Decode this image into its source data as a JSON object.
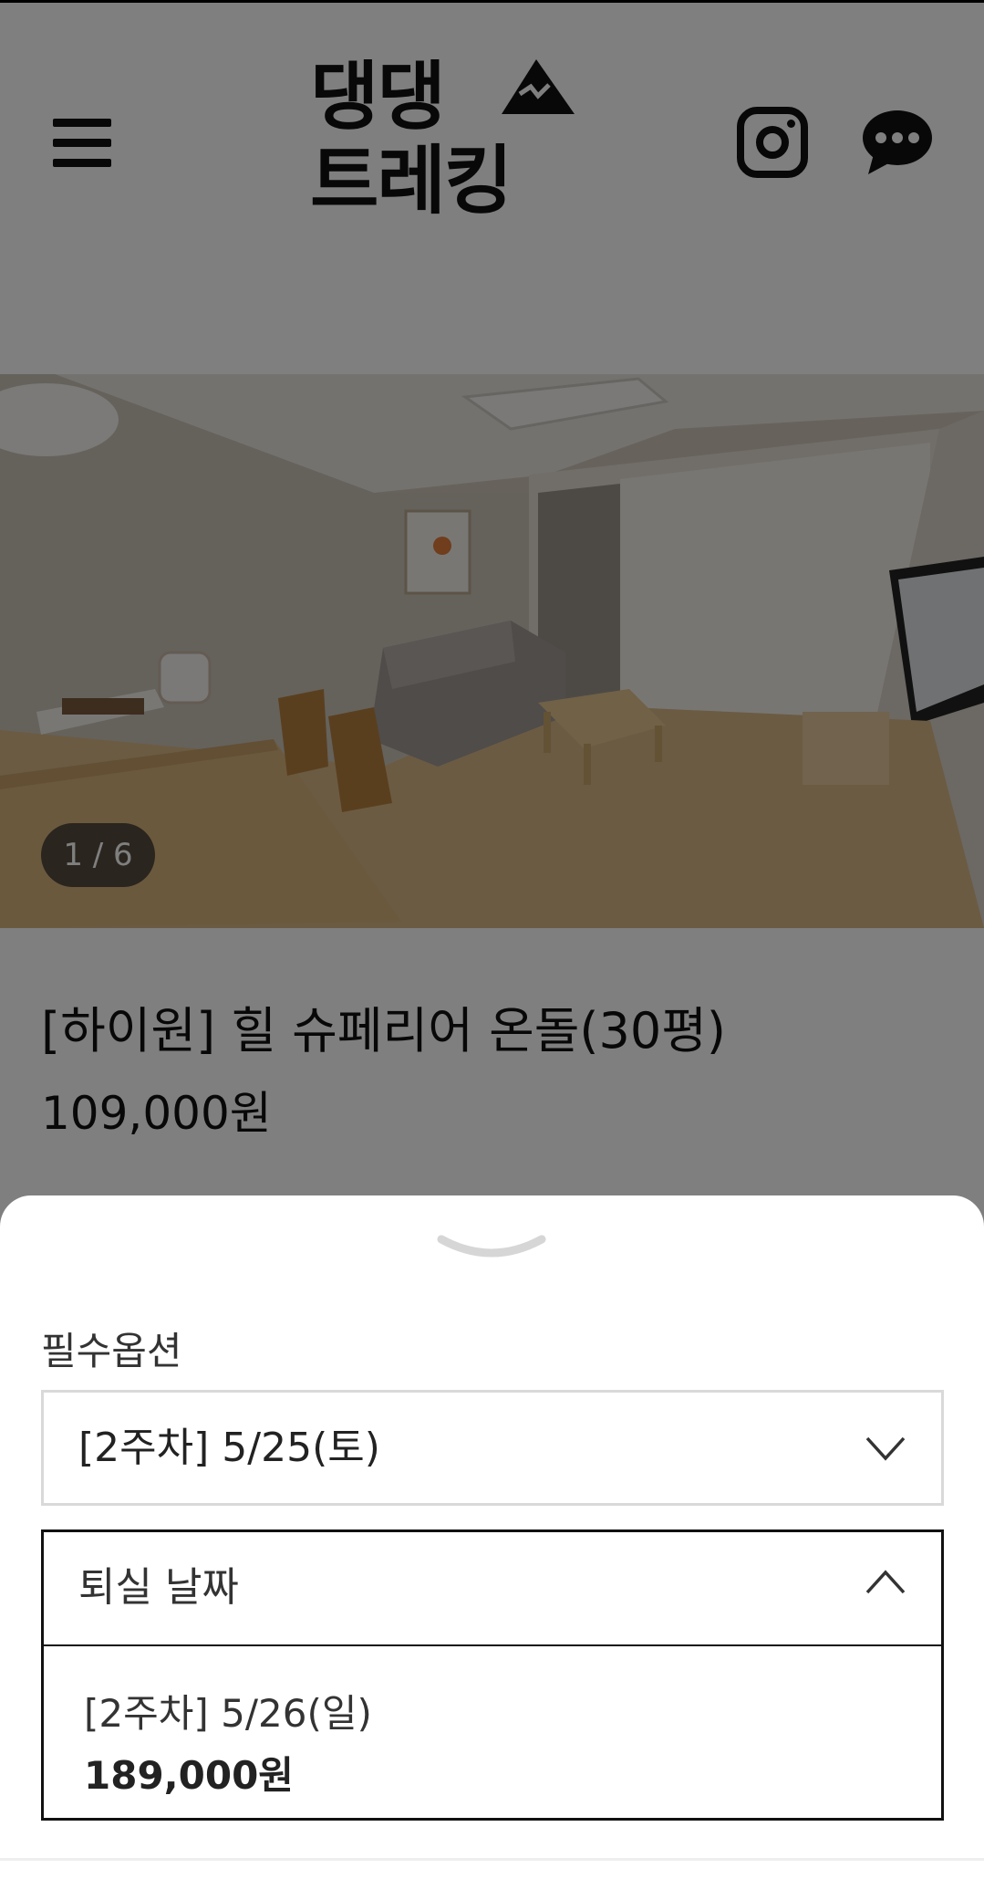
{
  "header": {
    "logo_text": "댕댕\n트레킹",
    "menu_icon": "hamburger-icon",
    "instagram_icon": "instagram-icon",
    "chat_icon": "chat-bubble-icon"
  },
  "gallery": {
    "counter": "1 / 6"
  },
  "product": {
    "title": "[하이원] 힐 슈페리어 온돌(30평)",
    "price": "109,000원"
  },
  "options_sheet": {
    "section_label": "필수옵션",
    "checkin_select": {
      "value": "[2주차] 5/25(토)",
      "state": "collapsed"
    },
    "checkout_select": {
      "placeholder": "퇴실 날짜",
      "state": "expanded"
    },
    "checkout_options": [
      {
        "label": "[2주차] 5/26(일)",
        "price": "189,000원"
      }
    ]
  },
  "colors": {
    "overlay": "#000000",
    "text": "#111111",
    "border_light": "#d9d9d9"
  }
}
